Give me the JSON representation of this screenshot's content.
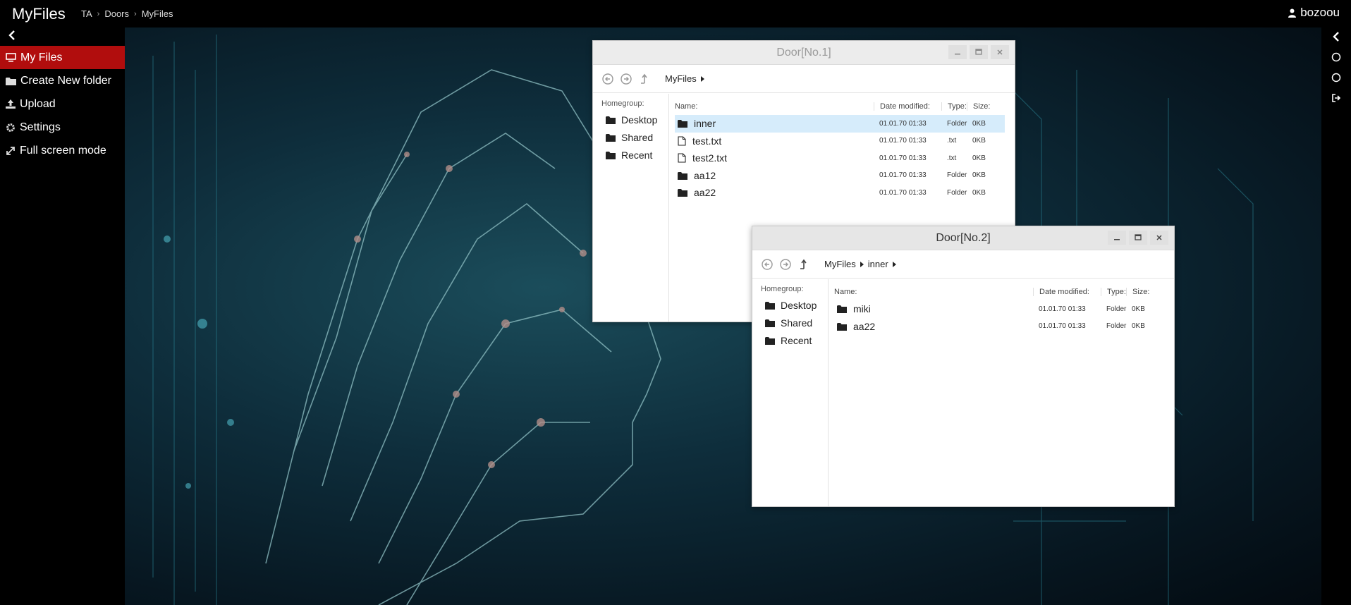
{
  "app": {
    "title": "MyFiles",
    "user": "bozoou"
  },
  "breadcrumb": [
    "TA",
    "Doors",
    "MyFiles"
  ],
  "sidebar": {
    "items": [
      {
        "label": "My Files",
        "icon": "monitor-icon",
        "active": true
      },
      {
        "label": "Create New folder",
        "icon": "folder-icon",
        "active": false
      },
      {
        "label": "Upload",
        "icon": "upload-icon",
        "active": false
      },
      {
        "label": "Settings",
        "icon": "gear-icon",
        "active": false
      },
      {
        "label": "Full screen mode",
        "icon": "expand-icon",
        "active": false
      }
    ]
  },
  "colors": {
    "active_menu": "#b10d0d",
    "selected_row": "#d6ecfb",
    "topbar": "#000000"
  },
  "windows": [
    {
      "title": "Door[No.1]",
      "path": [
        "MyFiles"
      ],
      "homegroup_label": "Homegroup:",
      "places": [
        "Desktop",
        "Shared",
        "Recent"
      ],
      "columns": {
        "name": "Name:",
        "date": "Date modified:",
        "type": "Type:",
        "size": "Size:"
      },
      "rows": [
        {
          "name": "inner",
          "kind": "folder",
          "date": "01.01.70 01:33",
          "type": "Folder",
          "size": "0KB",
          "selected": true
        },
        {
          "name": "test.txt",
          "kind": "file",
          "date": "01.01.70 01:33",
          "type": ".txt",
          "size": "0KB"
        },
        {
          "name": "test2.txt",
          "kind": "file",
          "date": "01.01.70 01:33",
          "type": ".txt",
          "size": "0KB"
        },
        {
          "name": "aa12",
          "kind": "folder",
          "date": "01.01.70 01:33",
          "type": "Folder",
          "size": "0KB"
        },
        {
          "name": "aa22",
          "kind": "folder",
          "date": "01.01.70 01:33",
          "type": "Folder",
          "size": "0KB"
        }
      ]
    },
    {
      "title": "Door[No.2]",
      "path": [
        "MyFiles",
        "inner"
      ],
      "homegroup_label": "Homegroup:",
      "places": [
        "Desktop",
        "Shared",
        "Recent"
      ],
      "columns": {
        "name": "Name:",
        "date": "Date modified:",
        "type": "Type:",
        "size": "Size:"
      },
      "rows": [
        {
          "name": "miki",
          "kind": "folder",
          "date": "01.01.70 01:33",
          "type": "Folder",
          "size": "0KB"
        },
        {
          "name": "aa22",
          "kind": "folder",
          "date": "01.01.70 01:33",
          "type": "Folder",
          "size": "0KB"
        }
      ]
    }
  ]
}
